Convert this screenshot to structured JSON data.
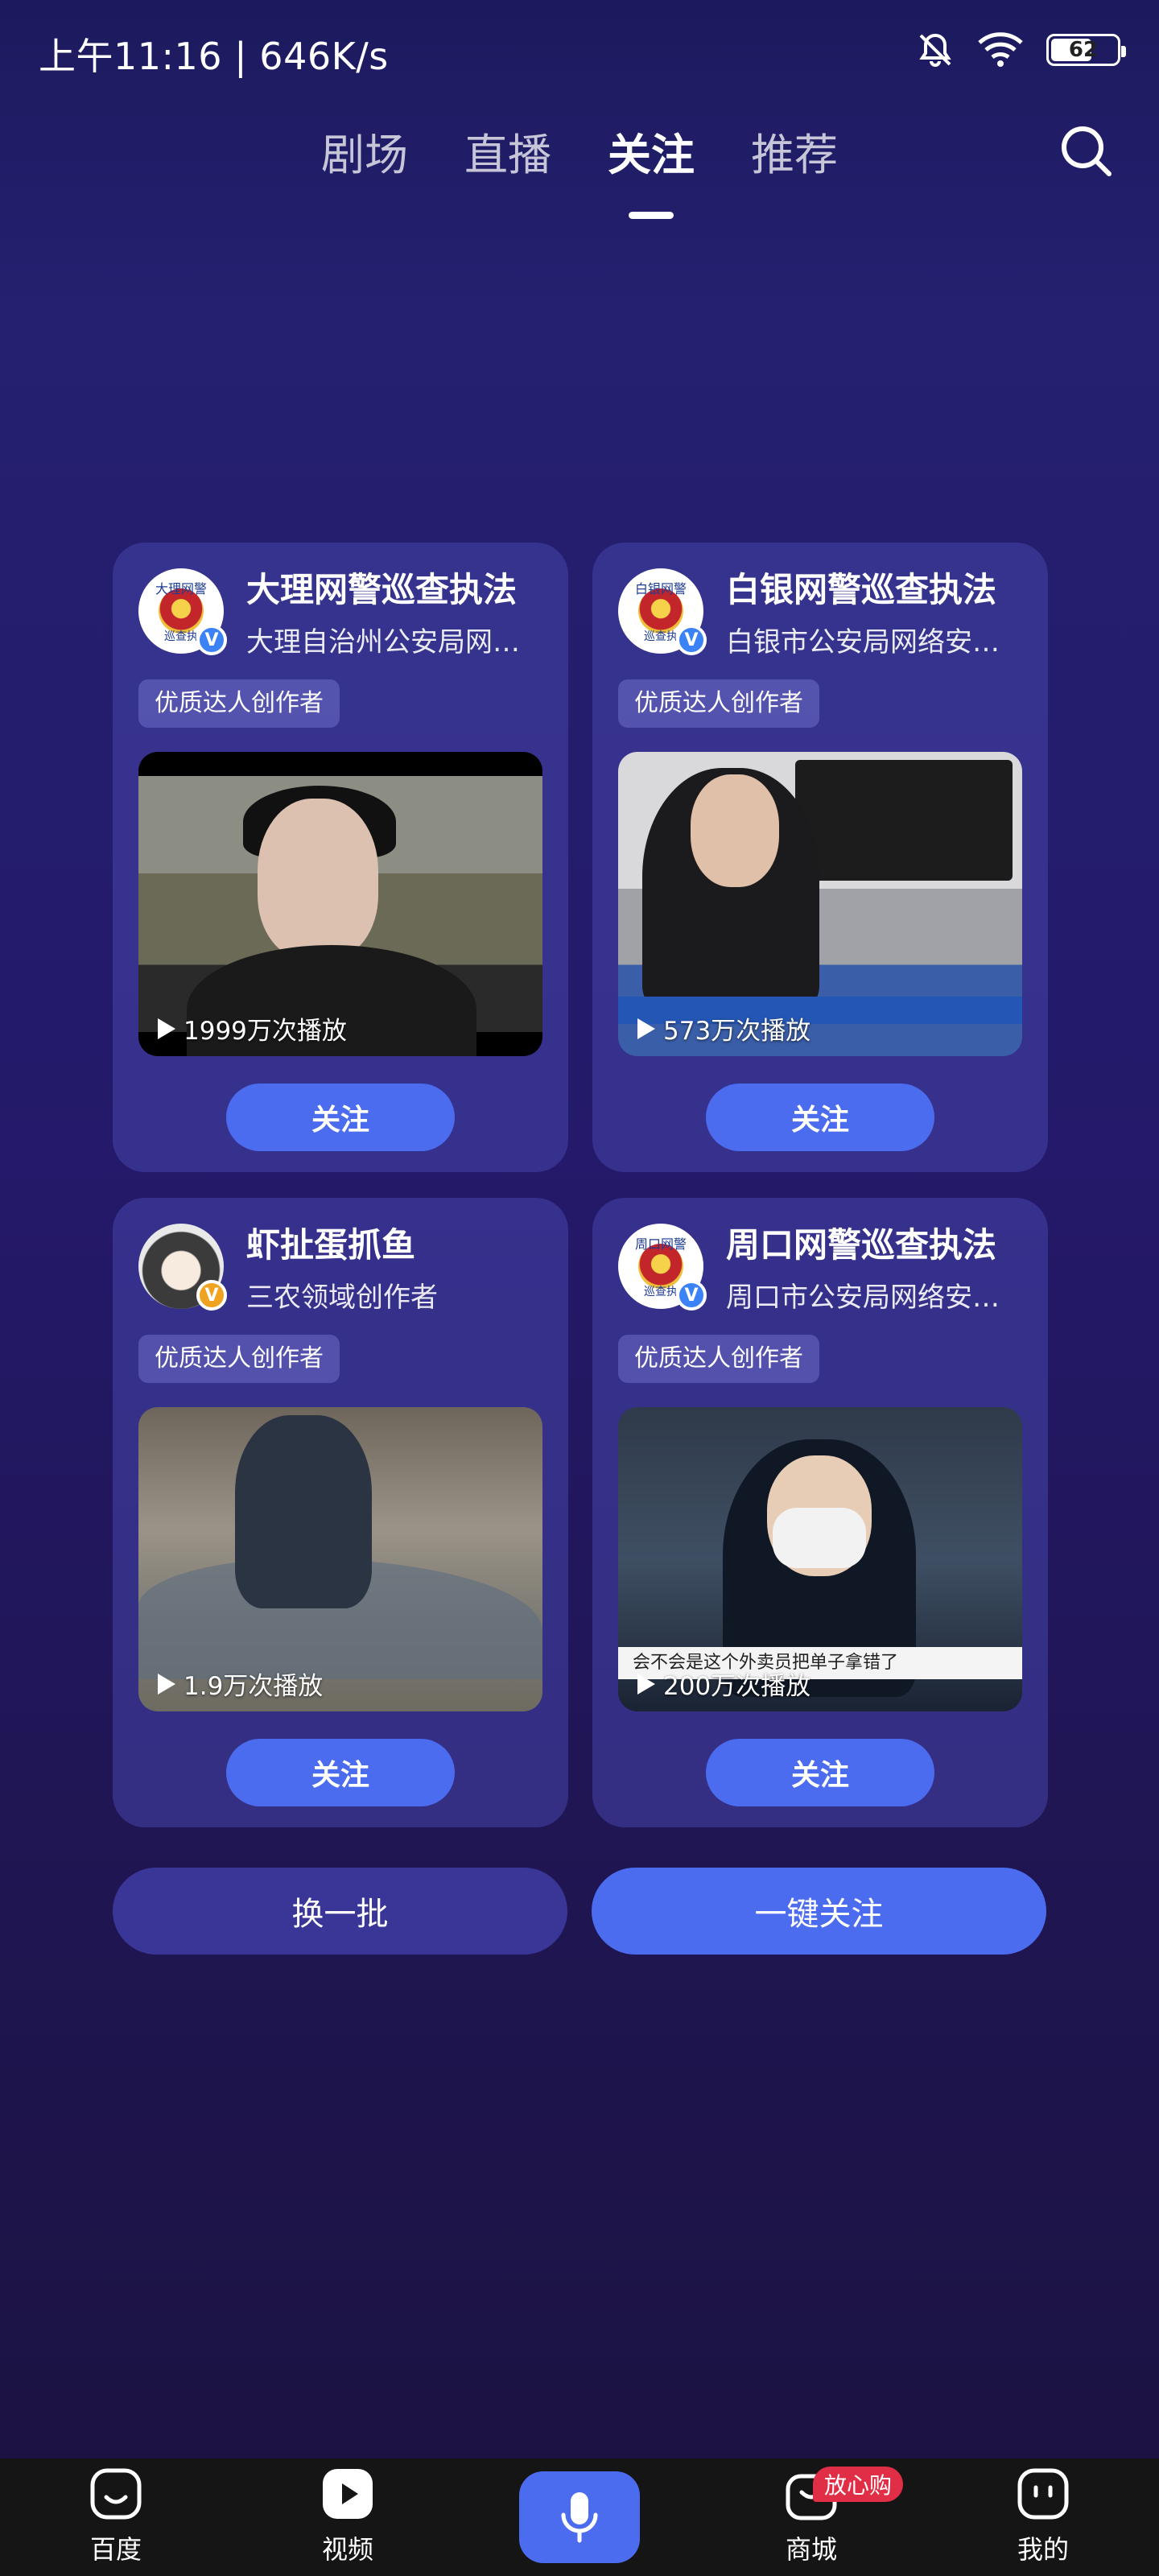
{
  "status": {
    "time_speed": "上午11:16 | 646K/s",
    "battery": "62",
    "battery_level": 0.62
  },
  "tabs": [
    {
      "label": "剧场"
    },
    {
      "label": "直播"
    },
    {
      "label": "关注",
      "active": true
    },
    {
      "label": "推荐"
    }
  ],
  "cards": [
    {
      "name": "大理网警巡查执法",
      "desc": "大理自治州公安局网…",
      "avatar_top": "大理网警",
      "avatar_bottom": "巡查执",
      "tag": "优质达人创作者",
      "plays": "1999万次播放",
      "follow": "关注"
    },
    {
      "name": "白银网警巡查执法",
      "desc": "白银市公安局网络安…",
      "avatar_top": "白银网警",
      "avatar_bottom": "巡查执",
      "tag": "优质达人创作者",
      "plays": "573万次播放",
      "follow": "关注"
    },
    {
      "name": "虾扯蛋抓鱼",
      "desc": "三农领域创作者",
      "tag": "优质达人创作者",
      "plays": "1.9万次播放",
      "follow": "关注"
    },
    {
      "name": "周口网警巡查执法",
      "desc": "周口市公安局网络安…",
      "avatar_top": "周口网警",
      "avatar_bottom": "巡查执",
      "tag": "优质达人创作者",
      "plays": "200万次播放",
      "ticker": "会不会是这个外卖员把单子拿错了",
      "follow": "关注"
    }
  ],
  "actions": {
    "batch": "换一批",
    "follow_all": "一键关注"
  },
  "nav": [
    {
      "label": "百度",
      "icon": "smile-face-icon"
    },
    {
      "label": "视频",
      "icon": "play-video-icon"
    },
    {
      "label": "",
      "icon": "microphone-icon"
    },
    {
      "label": "商城",
      "icon": "shopping-bag-icon",
      "badge": "放心购"
    },
    {
      "label": "我的",
      "icon": "profile-face-icon"
    }
  ],
  "colors": {
    "accent": "#4c6cf0",
    "card_bg": "#34339a",
    "badge_red": "#e02e46"
  }
}
